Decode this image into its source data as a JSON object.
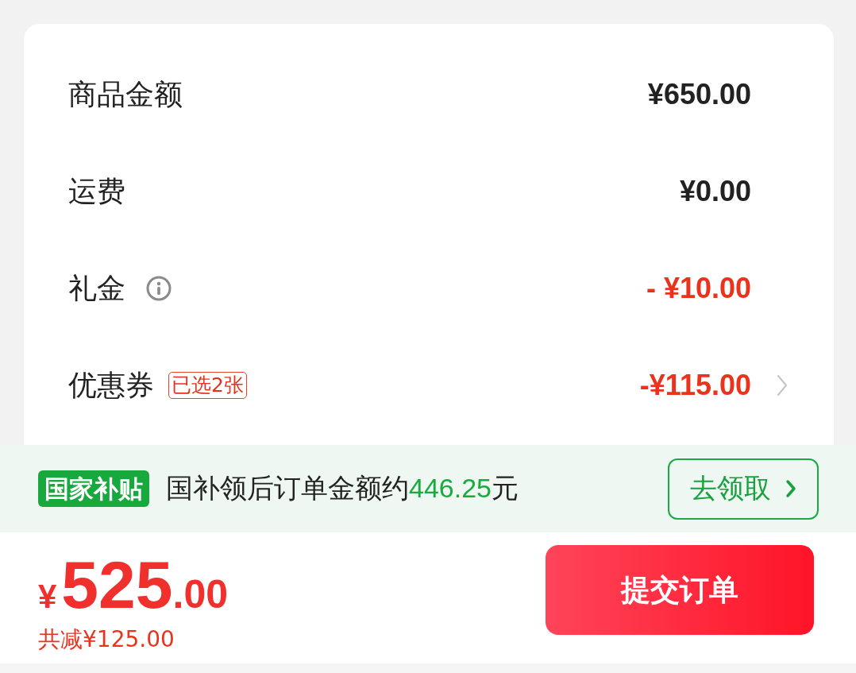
{
  "summary": {
    "rows": [
      {
        "label": "商品金额",
        "value": "¥650.00",
        "discount": false,
        "info": false,
        "expandable": false
      },
      {
        "label": "运费",
        "value": "¥0.00",
        "discount": false,
        "info": false,
        "expandable": false
      },
      {
        "label": "礼金",
        "value": "- ¥10.00",
        "discount": true,
        "info": true,
        "expandable": false
      },
      {
        "label": "优惠券",
        "badge": "已选2张",
        "value": "-¥115.00",
        "discount": true,
        "info": false,
        "expandable": true
      }
    ]
  },
  "subsidy": {
    "tag": "国家补贴",
    "text": "国补领后订单金额约",
    "amount": "446.25",
    "unit": "元",
    "button": "去领取"
  },
  "checkout": {
    "price": {
      "currency": "¥",
      "integer": "525",
      "decimal": ".00"
    },
    "savings": "共减¥125.00",
    "submit": "提交订单"
  }
}
